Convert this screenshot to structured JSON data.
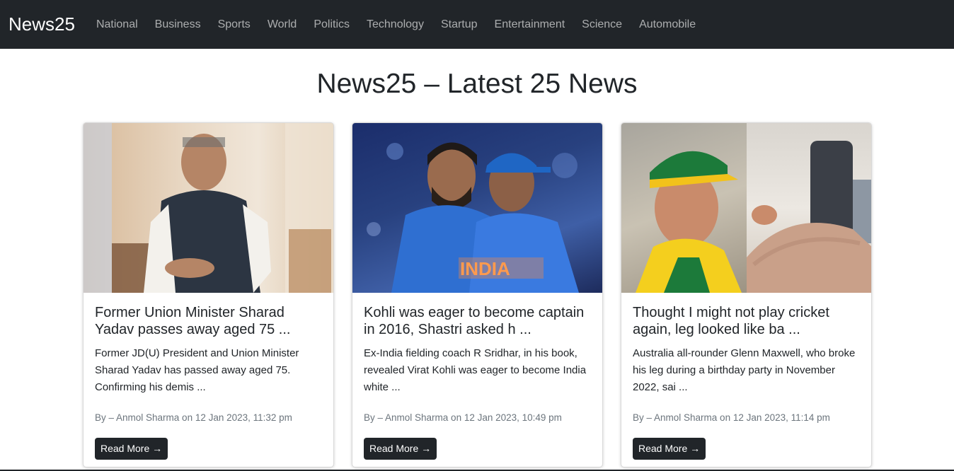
{
  "navbar": {
    "brand": "News25",
    "links": [
      "National",
      "Business",
      "Sports",
      "World",
      "Politics",
      "Technology",
      "Startup",
      "Entertainment",
      "Science",
      "Automobile"
    ]
  },
  "page": {
    "title": "News25 – Latest 25 News"
  },
  "cards": [
    {
      "title": "Former Union Minister Sharad Yadav passes away aged 75 ...",
      "description": "Former JD(U) President and Union Minister Sharad Yadav has passed away aged 75. Confirming his demis ...",
      "meta": "By – Anmol Sharma on 12 Jan 2023, 11:32 pm",
      "button": "Read More →"
    },
    {
      "title": "Kohli was eager to become captain in 2016, Shastri asked h ...",
      "description": "Ex-India fielding coach R Sridhar, in his book, revealed Virat Kohli was eager to become India white ...",
      "meta": "By – Anmol Sharma on 12 Jan 2023, 10:49 pm",
      "button": "Read More →"
    },
    {
      "title": "Thought I might not play cricket again, leg looked like ba ...",
      "description": "Australia all-rounder Glenn Maxwell, who broke his leg during a birthday party in November 2022, sai ...",
      "meta": "By – Anmol Sharma on 12 Jan 2023, 11:14 pm",
      "button": "Read More →"
    }
  ],
  "images": {
    "card2_jersey_text": "INDIA"
  },
  "colors": {
    "navbar_bg": "#212529",
    "button_bg": "#212529",
    "meta_text": "#6c757d"
  }
}
